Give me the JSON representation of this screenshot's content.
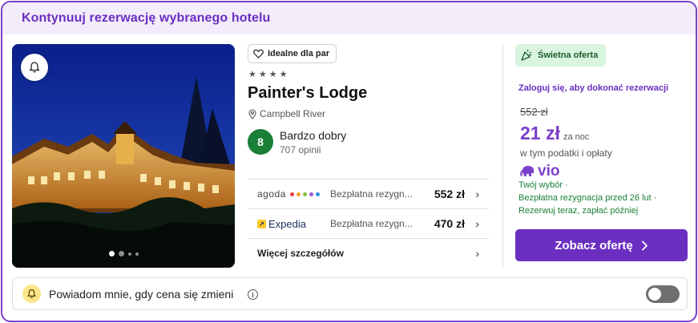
{
  "header": {
    "title": "Kontynuuj rezerwację wybranego hotelu"
  },
  "photo": {
    "carousel_total": 4,
    "carousel_active": 1
  },
  "hotel": {
    "tag": "Idealne dla par",
    "stars": 4,
    "name": "Painter's Lodge",
    "location": "Campbell River",
    "rating_score": "8",
    "rating_label": "Bardzo dobry",
    "rating_count": "707 opinii"
  },
  "offers": [
    {
      "provider": "agoda",
      "cancellation": "Bezpłatna rezygn...",
      "price": "552 zł"
    },
    {
      "provider": "Expedia",
      "cancellation": "Bezpłatna rezygn...",
      "price": "470 zł"
    }
  ],
  "more_details": "Więcej szczegółów",
  "deal": {
    "badge": "Świetna oferta",
    "login_prompt": "Zaloguj się, aby dokonać rezerwacji",
    "old_price": "552 zł",
    "new_price": "21 zł",
    "per_night": "za noc",
    "taxes": "w tym podatki i opłaty",
    "partner": "vio",
    "perks": [
      "Twój wybór ·",
      "Bezpłatna rezygnacja przed 26 lut ·",
      "Rezerwuj teraz, zapłać później"
    ],
    "cta": "Zobacz ofertę"
  },
  "notify": {
    "label": "Powiadom mnie, gdy cena się zmieni",
    "enabled": false
  },
  "colors": {
    "accent": "#6b2fc0",
    "header_bg": "#f3ecfb",
    "rating_green": "#1a7f37",
    "deal_bg": "#d9f5df"
  }
}
